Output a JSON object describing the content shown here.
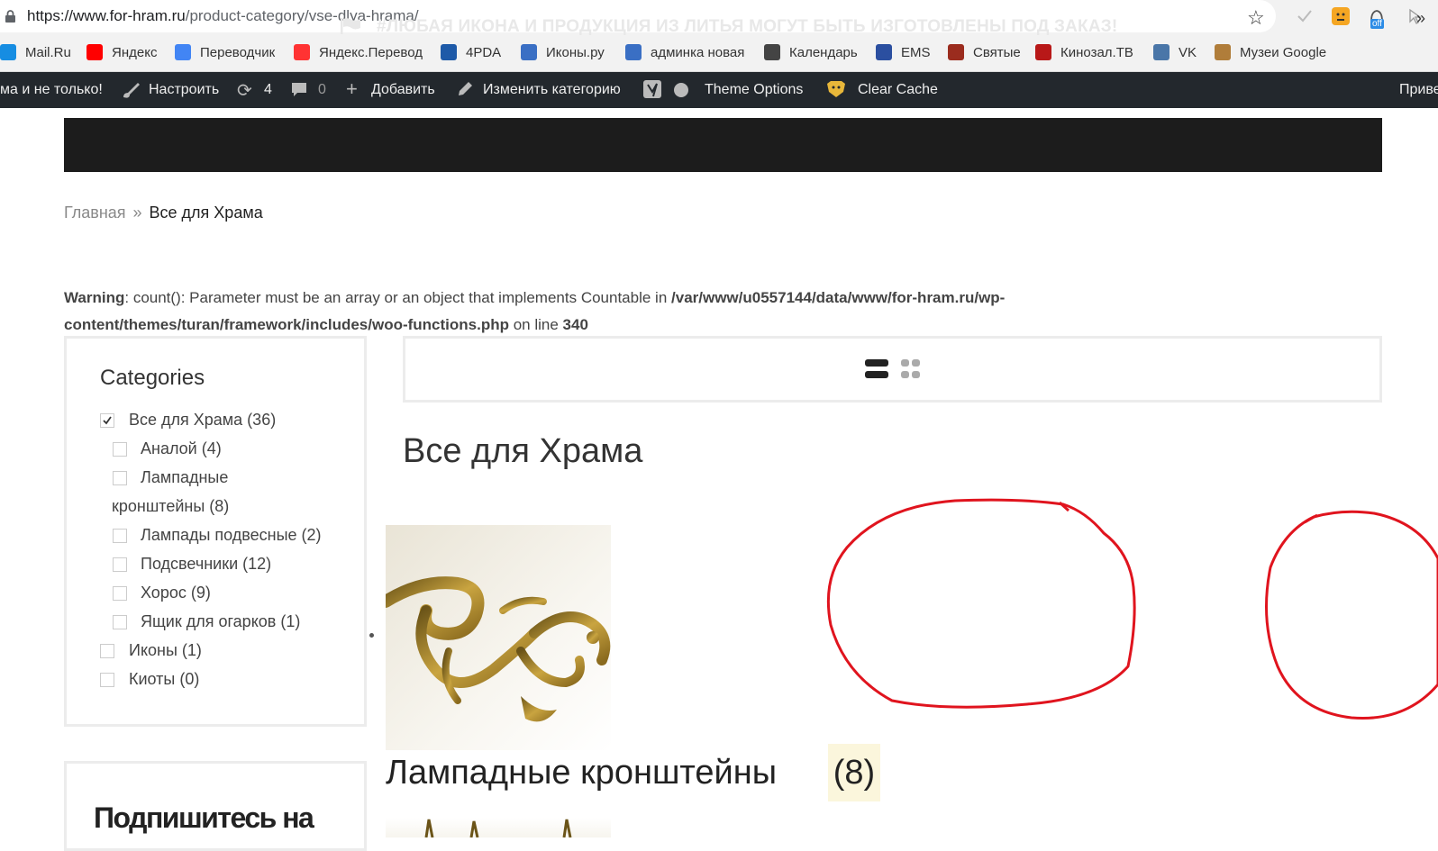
{
  "browser": {
    "url_domain": "https://www.for-hram.ru",
    "url_path": "/product-category/vse-dlya-hrama/",
    "extension_badge": "off"
  },
  "bookmarks": [
    {
      "label": "Mail.Ru",
      "icon": "mailru-icon",
      "color": "#168de2"
    },
    {
      "label": "Яндекс",
      "icon": "yandex-icon",
      "color": "#ff0000"
    },
    {
      "label": "Переводчик",
      "icon": "translate-icon",
      "color": "#4285f4"
    },
    {
      "label": "Яндекс.Перевод",
      "icon": "yandex-translate-icon",
      "color": "#ff3333"
    },
    {
      "label": "4PDA",
      "icon": "4pda-icon",
      "color": "#1e5aa8"
    },
    {
      "label": "Иконы.ру",
      "icon": "ikony-icon",
      "color": "#3a6fc4"
    },
    {
      "label": "админка новая",
      "icon": "admin-icon",
      "color": "#3a6fc4"
    },
    {
      "label": "Календарь",
      "icon": "calendar-icon",
      "color": "#444"
    },
    {
      "label": "EMS",
      "icon": "ems-icon",
      "color": "#2b4fa0"
    },
    {
      "label": "Святые",
      "icon": "saints-icon",
      "color": "#9b2c1e"
    },
    {
      "label": "Кинозал.ТВ",
      "icon": "kinozal-icon",
      "color": "#b81818"
    },
    {
      "label": "VK",
      "icon": "vk-icon",
      "color": "#4a76a8"
    },
    {
      "label": "Музеи Google",
      "icon": "museums-icon",
      "color": "#b07d3a"
    }
  ],
  "bookmarks_more": "»",
  "adminbar": {
    "site_name": "ма и не только!",
    "customize": "Настроить",
    "updates_count": "4",
    "comments_count": "0",
    "add_new": "Добавить",
    "edit_category": "Изменить категорию",
    "theme_options": "Theme Options",
    "clear_cache": "Clear Cache",
    "greeting": "Приве"
  },
  "notice": {
    "text": "#ЛЮБАЯ ИКОНА И ПРОДУКЦИЯ ИЗ ЛИТЬЯ МОГУТ БЫТЬ ИЗГОТОВЛЕНЫ ПОД ЗАКАЗ!"
  },
  "breadcrumb": {
    "home": "Главная",
    "separator": "»",
    "current": "Все для Храма"
  },
  "warning": {
    "label": "Warning",
    "message": ": count(): Parameter must be an array or an object that implements Countable in ",
    "path": "/var/www/u0557144/data/www/for-hram.ru/wp-content/themes/turan/framework/includes/woo-functions.php",
    "line_text": " on line ",
    "line": "340"
  },
  "sidebar": {
    "title": "Categories",
    "categories": [
      {
        "label": "Все для Храма (36)",
        "checked": true
      },
      {
        "label": "Аналой (4)",
        "checked": false
      },
      {
        "label": "Лампадные",
        "checked": false
      },
      {
        "label": "кронштейны (8)",
        "checked": false
      },
      {
        "label": "Лампады подвесные (2)",
        "checked": false
      },
      {
        "label": "Подсвечники (12)",
        "checked": false
      },
      {
        "label": "Хорос (9)",
        "checked": false
      },
      {
        "label": "Ящик для огарков (1)",
        "checked": false
      },
      {
        "label": "Иконы (1)",
        "checked": false
      },
      {
        "label": "Киоты (0)",
        "checked": false
      }
    ],
    "subscribe_title": "Подпишитесь на"
  },
  "main": {
    "title": "Все для Храма",
    "product": {
      "title": "Лампадные кронштейны",
      "count": "(8)"
    }
  },
  "colors": {
    "accent_red": "#e0141e",
    "adminbar_bg": "#23282d",
    "notice_bg": "#1c1c1c"
  }
}
